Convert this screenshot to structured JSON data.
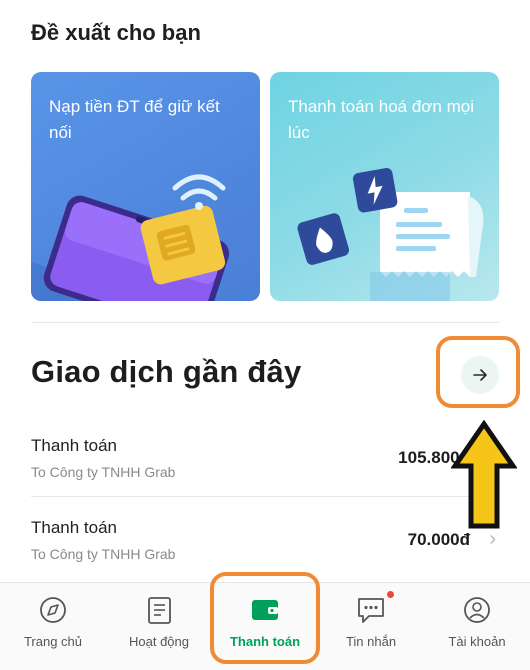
{
  "suggestions": {
    "title": "Đề xuất cho bạn",
    "cards": [
      {
        "label": "Nạp tiền ĐT để giữ kết nối",
        "icon": "phone-sim-icon"
      },
      {
        "label": "Thanh toán hoá đơn mọi lúc",
        "icon": "bill-receipt-icon"
      }
    ]
  },
  "recent": {
    "title": "Giao dịch gần đây",
    "view_all_icon": "arrow-right-icon",
    "transactions": [
      {
        "title": "Thanh toán",
        "subtitle": "To Công ty TNHH Grab",
        "amount": "105.800đ"
      },
      {
        "title": "Thanh toán",
        "subtitle": "To Công ty TNHH Grab",
        "amount": "70.000đ"
      }
    ]
  },
  "bottom_nav": {
    "active": "Thanh toán",
    "items": [
      {
        "label": "Trang chủ",
        "icon": "compass-icon"
      },
      {
        "label": "Hoạt động",
        "icon": "document-list-icon"
      },
      {
        "label": "Thanh toán",
        "icon": "wallet-icon"
      },
      {
        "label": "Tin nhắn",
        "icon": "chat-icon"
      },
      {
        "label": "Tài khoản",
        "icon": "user-icon"
      }
    ]
  },
  "colors": {
    "brand_green": "#00a05a",
    "highlight_orange": "#f08a35",
    "arrow_yellow": "#f5c518",
    "card_blue": "#4f87dc",
    "card_teal": "#7dd6e4",
    "notification_red": "#e94a3a"
  }
}
